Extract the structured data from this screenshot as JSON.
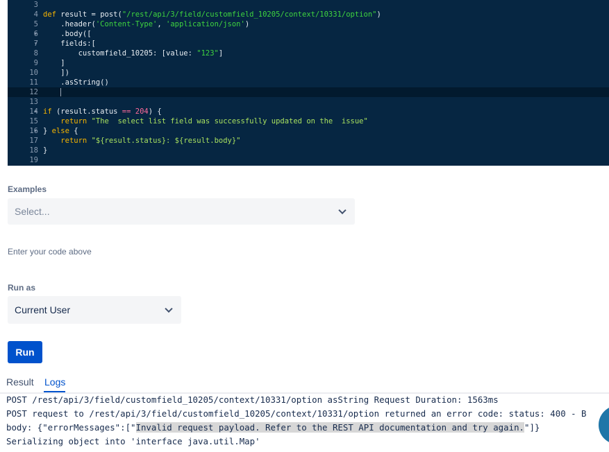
{
  "editor": {
    "lines": [
      {
        "n": "3",
        "fold": "",
        "segs": []
      },
      {
        "n": "4",
        "fold": "",
        "segs": [
          {
            "t": "def ",
            "c": "kw"
          },
          {
            "t": "result = post(",
            "c": ""
          },
          {
            "t": "\"/rest/api/3/field/customfield_10205/context/10331/option\"",
            "c": "str"
          },
          {
            "t": ")",
            "c": ""
          }
        ]
      },
      {
        "n": "5",
        "fold": "",
        "segs": [
          {
            "t": "    .header(",
            "c": ""
          },
          {
            "t": "'Content-Type'",
            "c": "str"
          },
          {
            "t": ", ",
            "c": ""
          },
          {
            "t": "'application/json'",
            "c": "str"
          },
          {
            "t": ")",
            "c": ""
          }
        ]
      },
      {
        "n": "6",
        "fold": "▾",
        "segs": [
          {
            "t": "    .body([",
            "c": ""
          }
        ]
      },
      {
        "n": "7",
        "fold": "▾",
        "segs": [
          {
            "t": "    fields:[",
            "c": ""
          }
        ]
      },
      {
        "n": "8",
        "fold": "",
        "segs": [
          {
            "t": "        customfield_10205: [value: ",
            "c": ""
          },
          {
            "t": "\"123\"",
            "c": "str"
          },
          {
            "t": "]",
            "c": ""
          }
        ]
      },
      {
        "n": "9",
        "fold": "",
        "segs": [
          {
            "t": "    ]",
            "c": ""
          }
        ]
      },
      {
        "n": "10",
        "fold": "",
        "segs": [
          {
            "t": "    ])",
            "c": ""
          }
        ]
      },
      {
        "n": "11",
        "fold": "",
        "segs": [
          {
            "t": "    .asString()",
            "c": ""
          }
        ]
      },
      {
        "n": "12",
        "fold": "",
        "segs": [
          {
            "t": "    ",
            "c": ""
          }
        ],
        "active": true,
        "cursor": true
      },
      {
        "n": "13",
        "fold": "",
        "segs": []
      },
      {
        "n": "14",
        "fold": "▾",
        "segs": [
          {
            "t": "if ",
            "c": "kw"
          },
          {
            "t": "(result.status ",
            "c": ""
          },
          {
            "t": "==",
            "c": "op"
          },
          {
            "t": " ",
            "c": ""
          },
          {
            "t": "204",
            "c": "num"
          },
          {
            "t": ") {",
            "c": ""
          }
        ]
      },
      {
        "n": "15",
        "fold": "",
        "segs": [
          {
            "t": "    ",
            "c": ""
          },
          {
            "t": "return ",
            "c": "kw"
          },
          {
            "t": "\"The  select list field was successfully updated on the  issue\"",
            "c": "str2"
          }
        ]
      },
      {
        "n": "16",
        "fold": "▾",
        "segs": [
          {
            "t": "} ",
            "c": ""
          },
          {
            "t": "else",
            "c": "kw"
          },
          {
            "t": " {",
            "c": ""
          }
        ]
      },
      {
        "n": "17",
        "fold": "",
        "segs": [
          {
            "t": "    ",
            "c": ""
          },
          {
            "t": "return ",
            "c": "kw"
          },
          {
            "t": "\"${result.status}: ${result.body}\"",
            "c": "str2"
          }
        ]
      },
      {
        "n": "18",
        "fold": "",
        "segs": [
          {
            "t": "}",
            "c": ""
          }
        ]
      },
      {
        "n": "19",
        "fold": "",
        "segs": []
      }
    ]
  },
  "examples": {
    "label": "Examples",
    "placeholder": "Select..."
  },
  "helper_text": "Enter your code above",
  "run_as": {
    "label": "Run as",
    "value": "Current User"
  },
  "run_button": "Run",
  "tabs": {
    "result": "Result",
    "logs": "Logs"
  },
  "logs": {
    "line1": "POST /rest/api/3/field/customfield_10205/context/10331/option asString Request Duration: 1563ms",
    "line2": "POST request to /rest/api/3/field/customfield_10205/context/10331/option returned an error code: status: 400 - B",
    "line3_pre": "body: {\"errorMessages\":[\"",
    "line3_hl": "Invalid request payload. Refer to the REST API documentation and try again.",
    "line3_post": "\"]}",
    "line4": "Serializing object into 'interface java.util.Map'"
  },
  "colors": {
    "accent": "#0052cc",
    "editor_bg": "#062642"
  }
}
